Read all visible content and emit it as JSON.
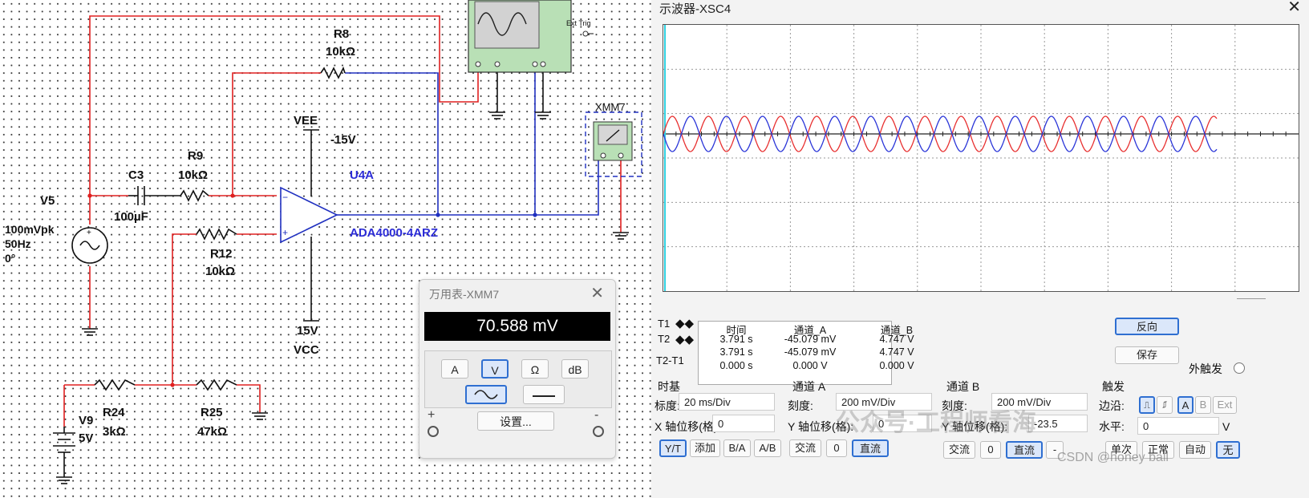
{
  "schematic": {
    "v5": {
      "name": "V5",
      "amp": "100mVpk",
      "freq": "50Hz",
      "phase": "0°"
    },
    "c3": {
      "name": "C3",
      "value": "100µF"
    },
    "r9": {
      "name": "R9",
      "value": "10kΩ"
    },
    "r8": {
      "name": "R8",
      "value": "10kΩ"
    },
    "r12": {
      "name": "R12",
      "value": "10kΩ"
    },
    "vee": {
      "name": "VEE",
      "value": "-15V"
    },
    "vcc": {
      "name": "VCC",
      "value": "15V"
    },
    "opamp": {
      "ref": "U4A",
      "part": "ADA4000-4ARZ"
    },
    "xmm": {
      "name": "XMM7"
    },
    "scope_ext": "Ext Trig",
    "v9": {
      "name": "V9",
      "value": "5V"
    },
    "r24": {
      "name": "R24",
      "value": "3kΩ"
    },
    "r25": {
      "name": "R25",
      "value": "47kΩ"
    }
  },
  "multimeter": {
    "title": "万用表-XMM7",
    "reading": "70.588 mV",
    "mode_buttons": [
      "A",
      "V",
      "Ω",
      "dB"
    ],
    "active_mode": "V",
    "set_label": "设置...",
    "plus": "+",
    "minus": "-"
  },
  "oscilloscope": {
    "title": "示波器-XSC4",
    "colors": {
      "channel_a": "#e83030",
      "channel_b": "#2a35d8"
    },
    "readout": {
      "headers": [
        "时间",
        "通道_A",
        "通道_B"
      ],
      "rows": [
        {
          "label": "T1",
          "time": "3.791 s",
          "a": "-45.079 mV",
          "b": "4.747 V"
        },
        {
          "label": "T2",
          "time": "3.791 s",
          "a": "-45.079 mV",
          "b": "4.747 V"
        },
        {
          "label": "T2-T1",
          "time": "0.000 s",
          "a": "0.000 V",
          "b": "0.000 V"
        }
      ]
    },
    "reverse_button": "反向",
    "save_button": "保存",
    "ext_trigger": "外触发",
    "timebase": {
      "title": "时基",
      "scale_label": "标度:",
      "scale": "20 ms/Div",
      "xpos_label": "X 轴位移(格):",
      "xpos": "0",
      "btns": [
        "Y/T",
        "添加",
        "B/A",
        "A/B"
      ]
    },
    "channel_a": {
      "title": "通道 A",
      "scale_label": "刻度:",
      "scale": "200 mV/Div",
      "ypos_label": "Y 轴位移(格):",
      "ypos": "0",
      "btns": [
        "交流",
        "0",
        "直流"
      ]
    },
    "channel_b": {
      "title": "通道 B",
      "scale_label": "刻度:",
      "scale": "200 mV/Div",
      "ypos_label": "Y 轴位移(格):",
      "ypos": "-23.5",
      "btns": [
        "交流",
        "0",
        "直流",
        "-"
      ]
    },
    "trigger": {
      "title": "触发",
      "edge_label": "边沿:",
      "level_label": "水平:",
      "level": "0",
      "level_unit": "V",
      "source_btns": [
        "A",
        "B",
        "Ext"
      ],
      "mode_btns": [
        "单次",
        "正常",
        "自动",
        "无"
      ]
    }
  },
  "watermark": {
    "text": "公众号·工程师看海",
    "credit": "CSDN @honey ball"
  }
}
